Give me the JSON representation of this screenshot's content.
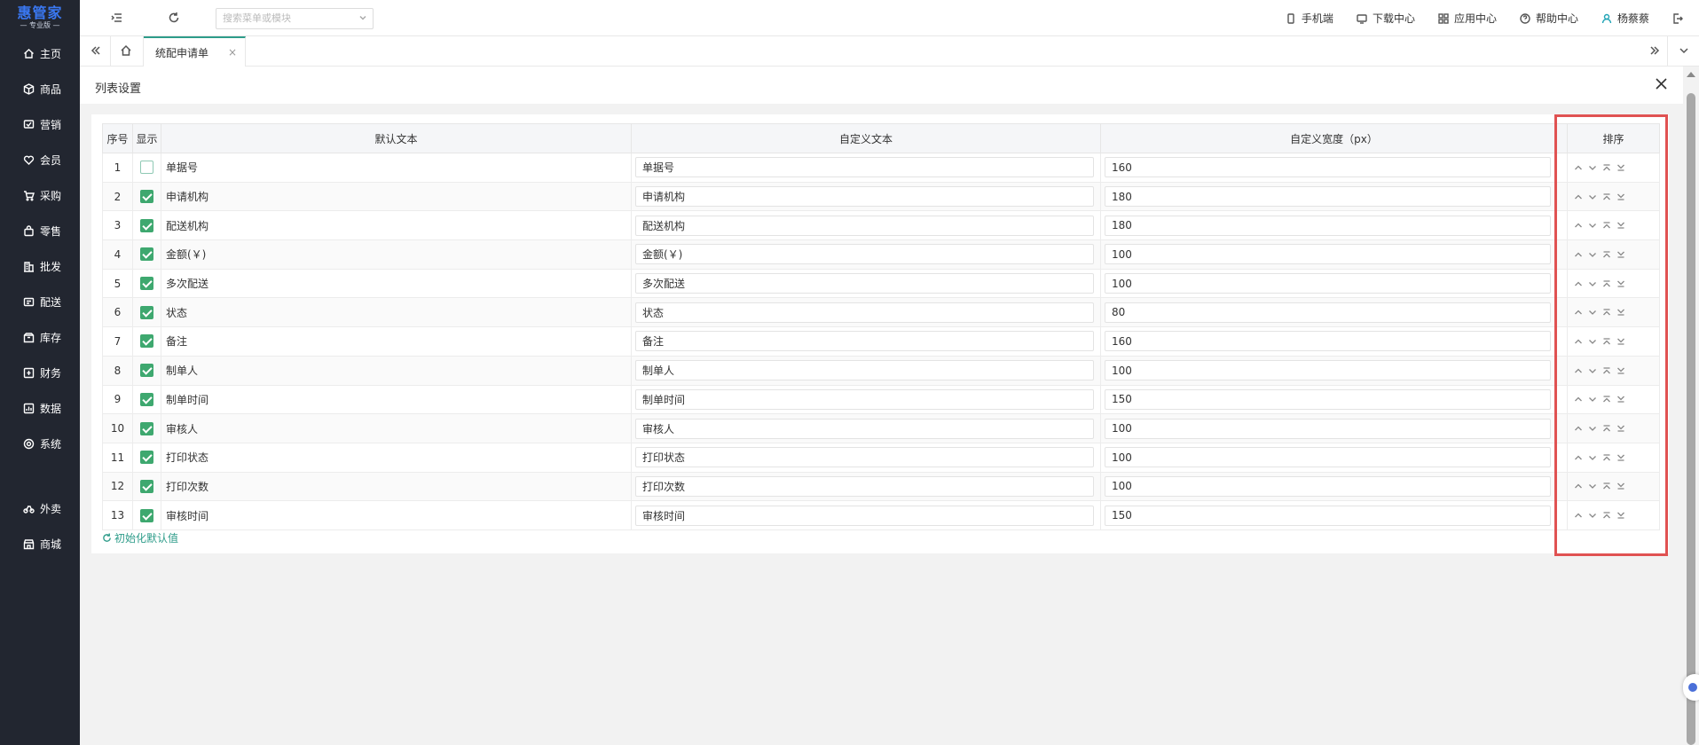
{
  "app": {
    "logo_main": "惠管家",
    "logo_sub": "— 专业版 —"
  },
  "sidebar": {
    "items": [
      {
        "label": "主页",
        "icon": "home-icon"
      },
      {
        "label": "商品",
        "icon": "cube-icon"
      },
      {
        "label": "营销",
        "icon": "promo-icon"
      },
      {
        "label": "会员",
        "icon": "heart-icon"
      },
      {
        "label": "采购",
        "icon": "cart-icon"
      },
      {
        "label": "零售",
        "icon": "bag-icon"
      },
      {
        "label": "批发",
        "icon": "building-icon"
      },
      {
        "label": "配送",
        "icon": "delivery-icon"
      },
      {
        "label": "库存",
        "icon": "box-icon"
      },
      {
        "label": "财务",
        "icon": "finance-icon"
      },
      {
        "label": "数据",
        "icon": "chart-icon"
      },
      {
        "label": "系统",
        "icon": "settings-icon"
      }
    ],
    "extra_items": [
      {
        "label": "外卖",
        "icon": "bike-icon"
      },
      {
        "label": "商城",
        "icon": "shop-icon"
      }
    ]
  },
  "topbar": {
    "search_placeholder": "搜索菜单或模块",
    "mobile": "手机端",
    "download": "下载中心",
    "apps": "应用中心",
    "help": "帮助中心",
    "user": "杨蔡蔡"
  },
  "tabs": [
    {
      "label": "统配申请单",
      "active": true
    }
  ],
  "panel": {
    "title": "列表设置",
    "reset_label": "初始化默认值"
  },
  "table": {
    "headers": {
      "index": "序号",
      "show": "显示",
      "default_text": "默认文本",
      "custom_text": "自定义文本",
      "custom_width": "自定义宽度（px）",
      "sort": "排序"
    },
    "rows": [
      {
        "index": "1",
        "show": false,
        "default": "单据号",
        "custom": "单据号",
        "width": "160"
      },
      {
        "index": "2",
        "show": true,
        "default": "申请机构",
        "custom": "申请机构",
        "width": "180"
      },
      {
        "index": "3",
        "show": true,
        "default": "配送机构",
        "custom": "配送机构",
        "width": "180"
      },
      {
        "index": "4",
        "show": true,
        "default": "金额(￥)",
        "custom": "金额(￥)",
        "width": "100"
      },
      {
        "index": "5",
        "show": true,
        "default": "多次配送",
        "custom": "多次配送",
        "width": "100"
      },
      {
        "index": "6",
        "show": true,
        "default": "状态",
        "custom": "状态",
        "width": "80"
      },
      {
        "index": "7",
        "show": true,
        "default": "备注",
        "custom": "备注",
        "width": "160"
      },
      {
        "index": "8",
        "show": true,
        "default": "制单人",
        "custom": "制单人",
        "width": "100"
      },
      {
        "index": "9",
        "show": true,
        "default": "制单时间",
        "custom": "制单时间",
        "width": "150"
      },
      {
        "index": "10",
        "show": true,
        "default": "审核人",
        "custom": "审核人",
        "width": "100"
      },
      {
        "index": "11",
        "show": true,
        "default": "打印状态",
        "custom": "打印状态",
        "width": "100"
      },
      {
        "index": "12",
        "show": true,
        "default": "打印次数",
        "custom": "打印次数",
        "width": "100"
      },
      {
        "index": "13",
        "show": true,
        "default": "审核时间",
        "custom": "审核时间",
        "width": "150"
      }
    ]
  },
  "colors": {
    "accent": "#2e9c8a",
    "checkbox": "#3ea86f",
    "sidebar_bg": "#222630",
    "highlight": "#e05252"
  }
}
